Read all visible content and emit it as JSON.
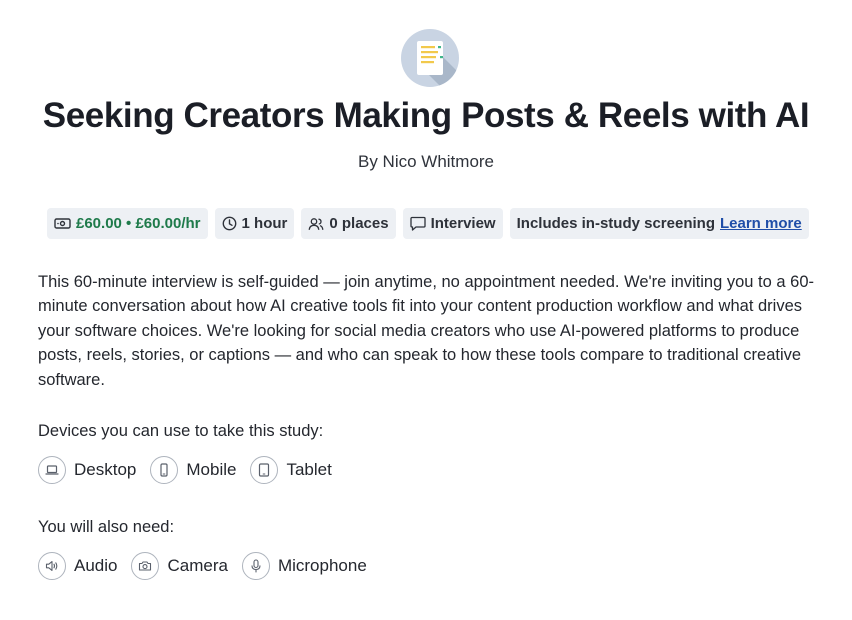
{
  "header": {
    "title": "Seeking Creators Making Posts & Reels with AI",
    "byline": "By Nico Whitmore"
  },
  "chips": {
    "pay": "£60.00 • £60.00/hr",
    "duration": "1 hour",
    "places": "0 places",
    "type": "Interview",
    "screening": "Includes in-study screening",
    "learn_more": "Learn more"
  },
  "description": "This 60-minute interview is self-guided — join anytime, no appointment needed. We're inviting you to a 60-minute conversation about how AI creative tools fit into your content production workflow and what drives your software choices. We're looking for social media creators who use AI-powered platforms to produce posts, reels, stories, or captions — and who can speak to how these tools compare to traditional creative software.",
  "devices": {
    "label": "Devices you can use to take this study:",
    "items": [
      {
        "label": "Desktop",
        "icon": "laptop-icon"
      },
      {
        "label": "Mobile",
        "icon": "phone-icon"
      },
      {
        "label": "Tablet",
        "icon": "tablet-icon"
      }
    ]
  },
  "requirements": {
    "label": "You will also need:",
    "items": [
      {
        "label": "Audio",
        "icon": "speaker-icon"
      },
      {
        "label": "Camera",
        "icon": "camera-icon"
      },
      {
        "label": "Microphone",
        "icon": "microphone-icon"
      }
    ]
  },
  "colors": {
    "pay_green": "#1e7a4a",
    "link_blue": "#1f4ea8",
    "chip_bg": "#edf0f4",
    "logo_bg": "#c9d4e3"
  }
}
